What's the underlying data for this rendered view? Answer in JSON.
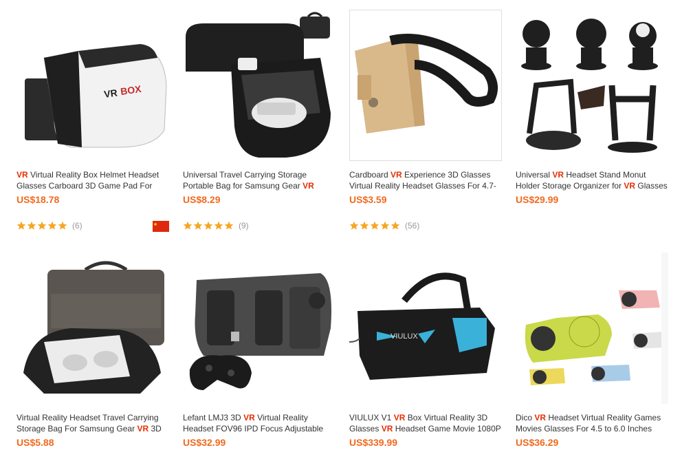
{
  "colors": {
    "accent": "#e62e04",
    "price": "#f2691e",
    "star": "#f5a623",
    "muted": "#999999"
  },
  "products": [
    {
      "title_lines": [
        [
          {
            "t": "VR",
            "hl": true
          },
          {
            "t": " Virtual Reality Box Helmet Headset"
          }
        ],
        [
          {
            "t": "Glasses Carboard 3D Game Pad For"
          }
        ]
      ],
      "price": "US$18.78",
      "rating": 5,
      "review_count": "(6)",
      "ships_from_icon": "china-flag-icon",
      "image": "vr-box-headset-image"
    },
    {
      "title_lines": [
        [
          {
            "t": "Universal Travel Carrying Storage"
          }
        ],
        [
          {
            "t": "Portable Bag for Samsung Gear "
          },
          {
            "t": "VR",
            "hl": true
          }
        ]
      ],
      "price": "US$8.29",
      "rating": 5,
      "review_count": "(9)",
      "image": "carry-case-image"
    },
    {
      "title_lines": [
        [
          {
            "t": "Cardboard "
          },
          {
            "t": "VR",
            "hl": true
          },
          {
            "t": " Experience 3D Glasses"
          }
        ],
        [
          {
            "t": "Virtual Reality Headset Glasses For 4.7-"
          }
        ]
      ],
      "price": "US$3.59",
      "rating": 5,
      "review_count": "(56)",
      "image": "cardboard-headset-image"
    },
    {
      "title_lines": [
        [
          {
            "t": "Universal "
          },
          {
            "t": "VR",
            "hl": true
          },
          {
            "t": " Headset Stand Monut"
          }
        ],
        [
          {
            "t": "Holder Storage Organizer for "
          },
          {
            "t": "VR",
            "hl": true
          },
          {
            "t": " Glasses"
          }
        ]
      ],
      "price": "US$29.99",
      "image": "headset-stand-image"
    },
    {
      "title_lines": [
        [
          {
            "t": "Virtual Reality Headset Travel Carrying"
          }
        ],
        [
          {
            "t": "Storage Bag For Samsung Gear "
          },
          {
            "t": "VR",
            "hl": true
          },
          {
            "t": " 3D"
          }
        ]
      ],
      "price": "US$5.88",
      "image": "travel-bag-image"
    },
    {
      "title_lines": [
        [
          {
            "t": "Lefant LMJ3 3D "
          },
          {
            "t": "VR",
            "hl": true
          },
          {
            "t": " Virtual Reality"
          }
        ],
        [
          {
            "t": "Headset FOV96 IPD Focus Adjustable"
          }
        ]
      ],
      "price": "US$32.99",
      "image": "lefant-headset-image"
    },
    {
      "title_lines": [
        [
          {
            "t": "VIULUX V1 "
          },
          {
            "t": "VR",
            "hl": true
          },
          {
            "t": " Box Virtual Reality 3D"
          }
        ],
        [
          {
            "t": "Glasses "
          },
          {
            "t": "VR",
            "hl": true
          },
          {
            "t": " Headset Game Movie 1080P"
          }
        ]
      ],
      "price": "US$339.99",
      "image": "viulux-headset-image",
      "logo_text": "VIULUX"
    },
    {
      "title_lines": [
        [
          {
            "t": "Dico "
          },
          {
            "t": "VR",
            "hl": true
          },
          {
            "t": " Headset Virtual Reality Games"
          }
        ],
        [
          {
            "t": "Movies Glasses For 4.5 to 6.0 Inches"
          }
        ]
      ],
      "price": "US$36.29",
      "image": "dico-headset-image"
    }
  ],
  "box_logo_text": "VR BOX"
}
